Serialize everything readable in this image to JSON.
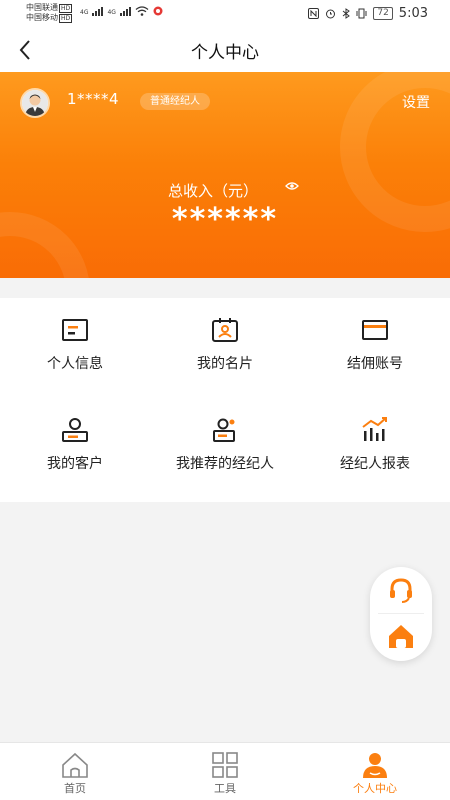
{
  "status_bar": {
    "carrier1": "中国联通",
    "carrier2": "中国移动",
    "hd": "HD",
    "net": "4G",
    "battery": "72",
    "time": "5:03"
  },
  "nav": {
    "title": "个人中心"
  },
  "profile": {
    "username": "1****4",
    "role": "普通经纪人",
    "settings_label": "设置",
    "income_label": "总收入（元）",
    "income_value": "******"
  },
  "grid": [
    {
      "label": "个人信息",
      "icon": "id-card-icon"
    },
    {
      "label": "我的名片",
      "icon": "business-card-icon"
    },
    {
      "label": "结佣账号",
      "icon": "bank-card-icon"
    },
    {
      "label": "我的客户",
      "icon": "customer-icon"
    },
    {
      "label": "我推荐的经纪人",
      "icon": "recommend-agent-icon"
    },
    {
      "label": "经纪人报表",
      "icon": "report-chart-icon"
    }
  ],
  "tabs": [
    {
      "label": "首页",
      "icon": "home-icon",
      "active": false
    },
    {
      "label": "工具",
      "icon": "grid-tools-icon",
      "active": false
    },
    {
      "label": "个人中心",
      "icon": "person-icon",
      "active": true
    }
  ],
  "colors": {
    "accent": "#fb7f10",
    "header_top": "#fe9a1e",
    "header_bottom": "#f96c05"
  }
}
